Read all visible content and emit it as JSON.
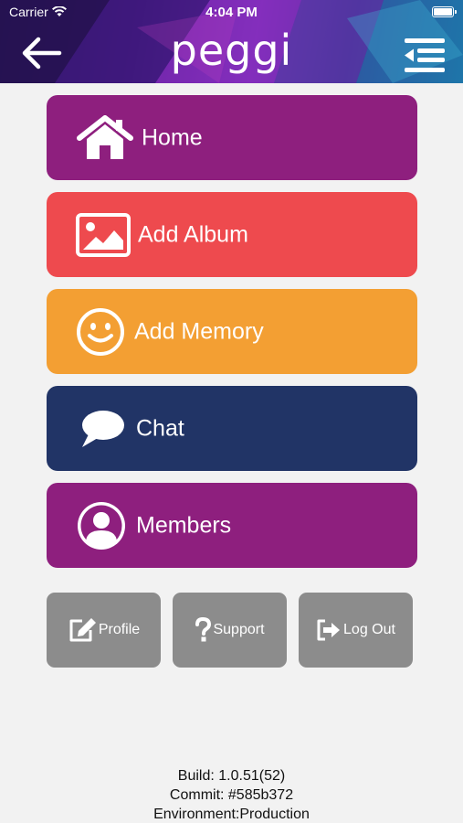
{
  "status_bar": {
    "carrier": "Carrier",
    "time": "4:04 PM"
  },
  "header": {
    "logo_text": "peggi"
  },
  "menu": [
    {
      "label": "Home",
      "icon": "home-icon",
      "color": "#8e1f7e"
    },
    {
      "label": "Add Album",
      "icon": "image-icon",
      "color": "#ee4a4e"
    },
    {
      "label": "Add Memory",
      "icon": "smiley-icon",
      "color": "#f39f33"
    },
    {
      "label": "Chat",
      "icon": "chat-bubble-icon",
      "color": "#213466"
    },
    {
      "label": "Members",
      "icon": "user-circle-icon",
      "color": "#8e1f7e"
    }
  ],
  "actions": [
    {
      "label": "Profile",
      "icon": "edit-icon"
    },
    {
      "label": "Support",
      "icon": "question-icon"
    },
    {
      "label": "Log Out",
      "icon": "logout-icon"
    }
  ],
  "footer": {
    "build": "Build: 1.0.51(52)",
    "commit": "Commit: #585b372",
    "environment": "Environment:Production"
  }
}
